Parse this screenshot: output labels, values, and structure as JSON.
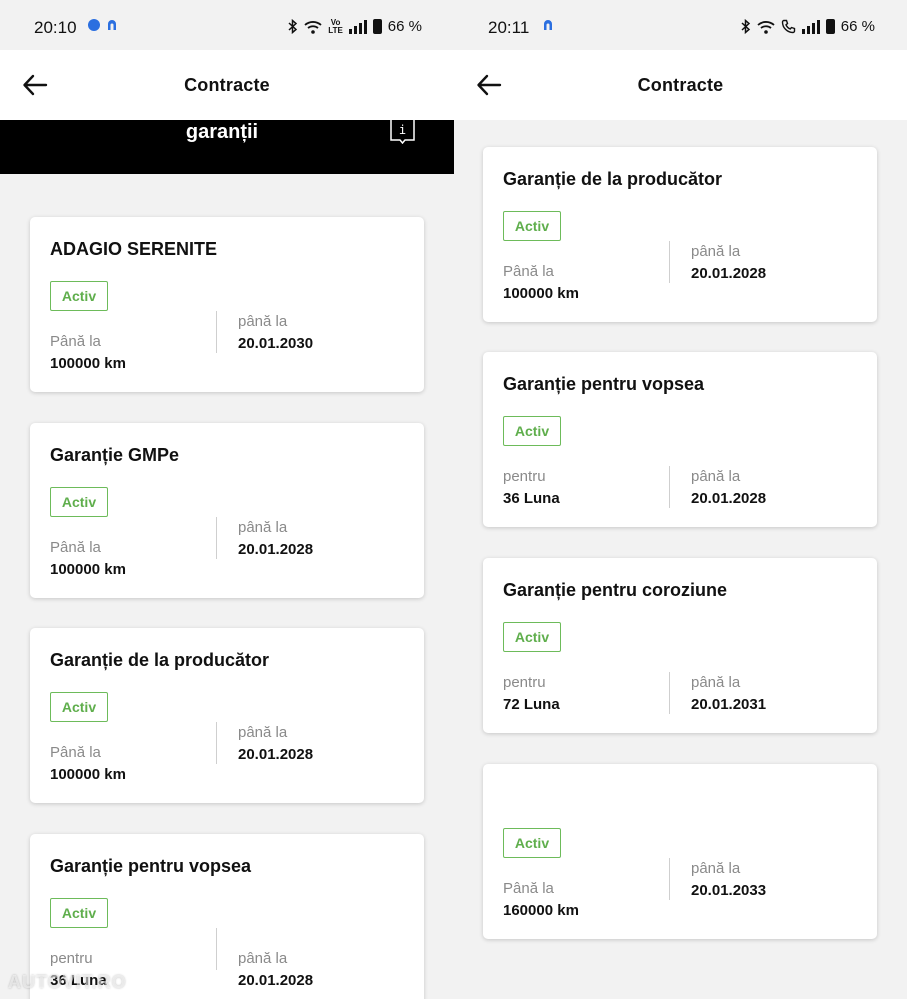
{
  "left": {
    "status": {
      "time": "20:10",
      "battery": "66 %"
    },
    "appbar": {
      "title": "Contracte"
    },
    "section_title": "garanții",
    "cards": [
      {
        "title": "ADAGIO SERENITE",
        "status": "Activ",
        "left_label": "Până la",
        "left_value": "100000 km",
        "right_label": "până la",
        "right_value": "20.01.2030"
      },
      {
        "title": "Garanție GMPe",
        "status": "Activ",
        "left_label": "Până la",
        "left_value": "100000 km",
        "right_label": "până la",
        "right_value": "20.01.2028"
      },
      {
        "title": "Garanție de la producător",
        "status": "Activ",
        "left_label": "Până la",
        "left_value": "100000 km",
        "right_label": "până la",
        "right_value": "20.01.2028"
      },
      {
        "title": "Garanție pentru vopsea",
        "status": "Activ",
        "left_label": "pentru",
        "left_value": "36 Luna",
        "right_label": "până la",
        "right_value": "20.01.2028"
      }
    ]
  },
  "right": {
    "status": {
      "time": "20:11",
      "battery": "66 %"
    },
    "appbar": {
      "title": "Contracte"
    },
    "cards": [
      {
        "title": "Garanție de la producător",
        "status": "Activ",
        "left_label": "Până la",
        "left_value": "100000 km",
        "right_label": "până la",
        "right_value": "20.01.2028"
      },
      {
        "title": "Garanție pentru vopsea",
        "status": "Activ",
        "left_label": "pentru",
        "left_value": "36 Luna",
        "right_label": "până la",
        "right_value": "20.01.2028"
      },
      {
        "title": "Garanție pentru coroziune",
        "status": "Activ",
        "left_label": "pentru",
        "left_value": "72 Luna",
        "right_label": "până la",
        "right_value": "20.01.2031"
      },
      {
        "title": "",
        "status": "Activ",
        "left_label": "Până la",
        "left_value": "160000 km",
        "right_label": "până la",
        "right_value": "20.01.2033"
      }
    ]
  },
  "watermark": "AUTOVIT.RO",
  "colors": {
    "accent_green": "#5fae4c",
    "header_black": "#000000",
    "background": "#f2f2f2"
  }
}
